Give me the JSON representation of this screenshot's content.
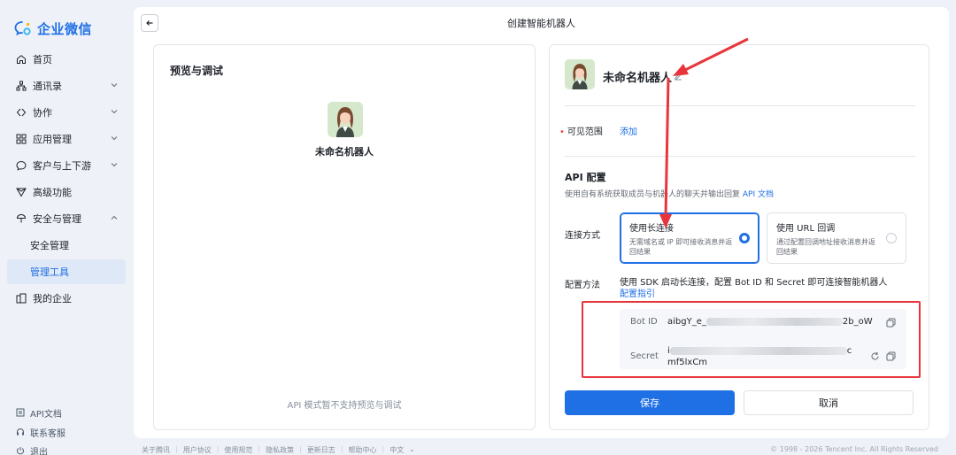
{
  "app": {
    "logo_text": "企业微信",
    "brand_color": "#1f6fe5"
  },
  "sidebar": {
    "items": [
      {
        "label": "首页",
        "icon": "home-icon"
      },
      {
        "label": "通讯录",
        "icon": "org-icon"
      },
      {
        "label": "协作",
        "icon": "collab-icon"
      },
      {
        "label": "应用管理",
        "icon": "apps-icon"
      },
      {
        "label": "客户与上下游",
        "icon": "chat-icon"
      },
      {
        "label": "高级功能",
        "icon": "diamond-icon"
      },
      {
        "label": "安全与管理",
        "icon": "shield-icon"
      },
      {
        "label": "安全管理"
      },
      {
        "label": "管理工具"
      },
      {
        "label": "我的企业",
        "icon": "building-icon"
      }
    ],
    "bottom": [
      {
        "label": "API文档",
        "icon": "doc-icon"
      },
      {
        "label": "联系客服",
        "icon": "support-icon"
      },
      {
        "label": "退出",
        "icon": "power-icon"
      }
    ]
  },
  "page": {
    "title": "创建智能机器人"
  },
  "preview": {
    "title": "预览与调试",
    "bot_name": "未命名机器人",
    "note": "API 模式暂不支持预览与调试"
  },
  "config": {
    "bot_name": "未命名机器人",
    "visibility_label": "可见范围",
    "visibility_action": "添加",
    "api_title": "API 配置",
    "api_desc": "使用自有系统获取成员与机器人的聊天并输出回复",
    "api_doc_link": "API 文档",
    "connect_label": "连接方式",
    "options": [
      {
        "title": "使用长连接",
        "desc": "无需域名或 IP 即可接收消息并返回结果",
        "selected": true
      },
      {
        "title": "使用 URL 回调",
        "desc": "通过配置回调地址接收消息并返回结果",
        "selected": false
      }
    ],
    "method_label": "配置方法",
    "method_text": "使用 SDK 启动长连接，配置 Bot ID 和 Secret 即可连接智能机器人",
    "method_link": "配置指引",
    "bot_id_label": "Bot ID",
    "bot_id_prefix": "aibgY_e_",
    "bot_id_suffix": "2b_oW",
    "secret_label": "Secret",
    "secret_prefix": "i",
    "secret_suffix_line1": "c",
    "secret_line2": "mf5lxCm",
    "save": "保存",
    "cancel": "取消"
  },
  "footer": {
    "links": [
      "关于腾讯",
      "用户协议",
      "使用规范",
      "隐私政策",
      "更新日志",
      "帮助中心",
      "中文"
    ],
    "copyright": "© 1998 - 2026 Tencent Inc. All Rights Reserved"
  }
}
